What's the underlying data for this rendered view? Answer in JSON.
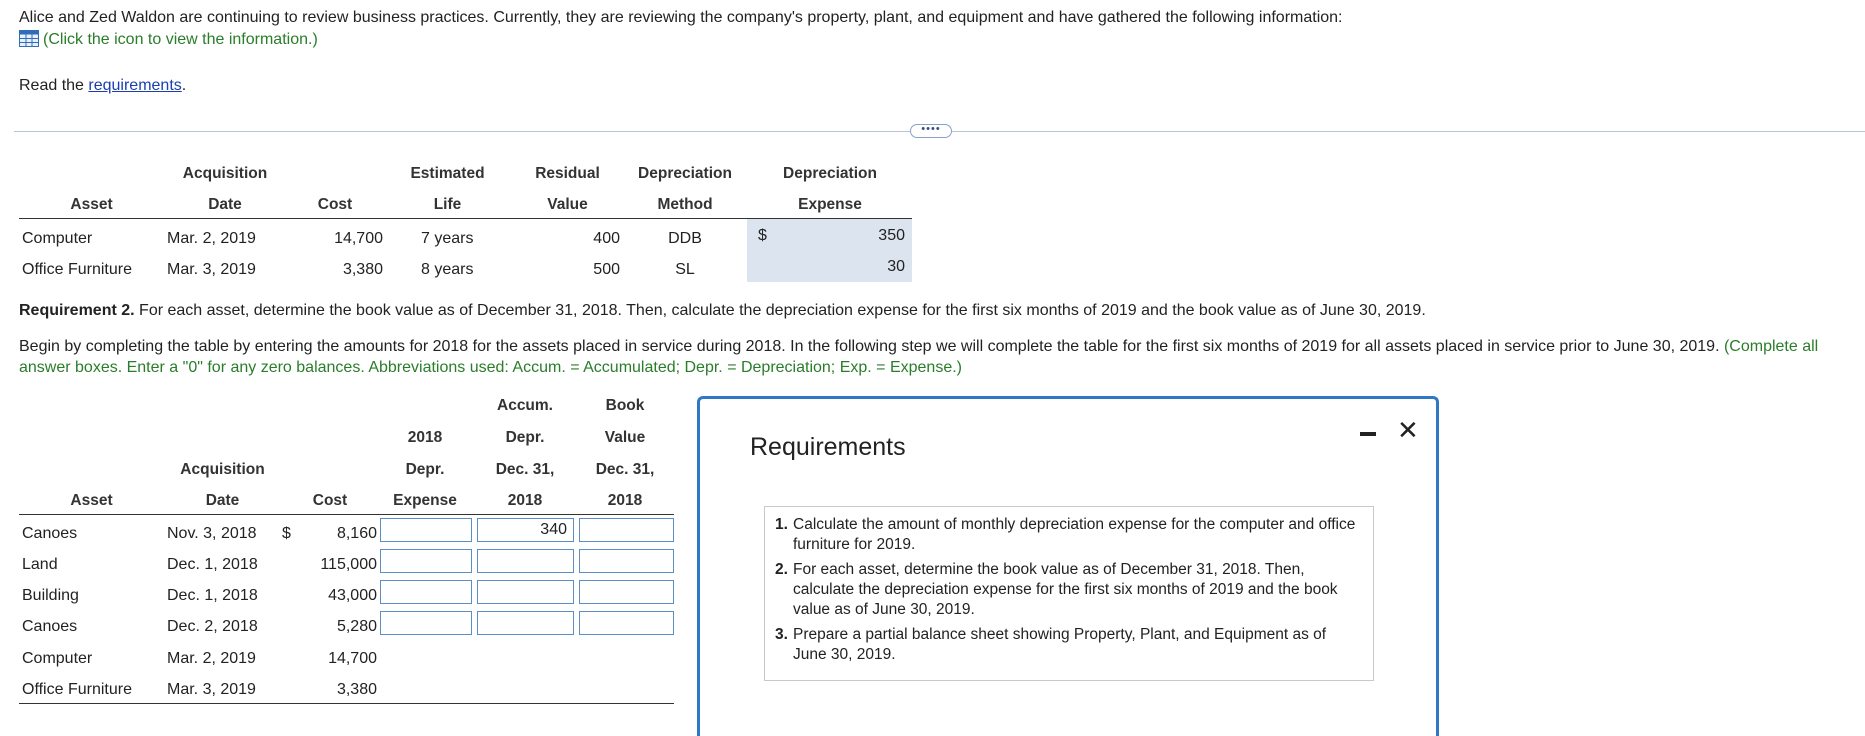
{
  "intro": {
    "line1": "Alice and Zed Waldon are continuing to review business practices. Currently, they are reviewing the company's property, plant, and equipment and have gathered the following information:",
    "click_text": "(Click the icon to view the information.)",
    "read_prefix": "Read the ",
    "requirements_link": "requirements",
    "read_suffix": "."
  },
  "more_button": "••••",
  "table1": {
    "headers": {
      "asset": "Asset",
      "acq_top": "Acquisition",
      "acq_bottom": "Date",
      "cost": "Cost",
      "life_top": "Estimated",
      "life_bottom": "Life",
      "resid_top": "Residual",
      "resid_bottom": "Value",
      "method_top": "Depreciation",
      "method_bottom": "Method",
      "exp_top": "Depreciation",
      "exp_bottom": "Expense"
    },
    "rows": [
      {
        "asset": "Computer",
        "date": "Mar. 2, 2019",
        "cost": "14,700",
        "life": "7 years",
        "residual": "400",
        "method": "DDB",
        "currency": "$",
        "expense": "350"
      },
      {
        "asset": "Office Furniture",
        "date": "Mar. 3, 2019",
        "cost": "3,380",
        "life": "8 years",
        "residual": "500",
        "method": "SL",
        "currency": "",
        "expense": "30"
      }
    ]
  },
  "requirement2": {
    "bold": "Requirement 2.",
    "text": " For each asset, determine the book value as of December 31, 2018. Then, calculate the depreciation expense for the first six months of 2019 and the book value as of June 30, 2019."
  },
  "instructions": {
    "black": "Begin by completing the table by entering the amounts for 2018 for the assets placed in service during 2018. In the following step we will complete the table for the first six months of 2019 for all assets placed in service prior to June 30, 2019. ",
    "green": "(Complete all answer boxes. Enter a \"0\" for any zero balances. Abbreviations used: Accum. = Accumulated; Depr. = Depreciation; Exp. = Expense.)"
  },
  "table2": {
    "headers": {
      "asset": "Asset",
      "acq_top": "Acquisition",
      "acq_bottom": "Date",
      "cost": "Cost",
      "depr_l1": "2018",
      "depr_l2": "Depr.",
      "depr_l3": "Expense",
      "accum_l1": "Accum.",
      "accum_l2": "Depr.",
      "accum_l3": "Dec. 31,",
      "accum_l4": "2018",
      "book_l1": "Book",
      "book_l2": "Value",
      "book_l3": "Dec. 31,",
      "book_l4": "2018"
    },
    "rows": [
      {
        "asset": "Canoes",
        "date": "Nov. 3, 2018",
        "currency": "$",
        "cost": "8,160",
        "depr": "",
        "accum": "340",
        "book": ""
      },
      {
        "asset": "Land",
        "date": "Dec. 1, 2018",
        "currency": "",
        "cost": "115,000",
        "depr": "",
        "accum": "",
        "book": ""
      },
      {
        "asset": "Building",
        "date": "Dec. 1, 2018",
        "currency": "",
        "cost": "43,000",
        "depr": "",
        "accum": "",
        "book": ""
      },
      {
        "asset": "Canoes",
        "date": "Dec. 2, 2018",
        "currency": "",
        "cost": "5,280",
        "depr": "",
        "accum": "",
        "book": ""
      },
      {
        "asset": "Computer",
        "date": "Mar. 2, 2019",
        "currency": "",
        "cost": "14,700"
      },
      {
        "asset": "Office Furniture",
        "date": "Mar. 3, 2019",
        "currency": "",
        "cost": "3,380"
      }
    ]
  },
  "modal": {
    "title": "Requirements",
    "minimize_glyph": "",
    "close_glyph": "✕",
    "items": [
      {
        "num": "1.",
        "text": "Calculate the amount of monthly depreciation expense for the computer and office furniture for 2019."
      },
      {
        "num": "2.",
        "text": "For each asset, determine the book value as of December 31, 2018. Then, calculate the depreciation expense for the first six months of 2019 and the book value as of June 30, 2019."
      },
      {
        "num": "3.",
        "text": "Prepare a partial balance sheet showing Property, Plant, and Equipment as of June 30, 2019."
      }
    ]
  },
  "colors": {
    "green_text": "#2a7d2a",
    "link_blue": "#1a3fb0",
    "input_border": "#5b8fc4",
    "shade": "#dce4ef",
    "modal_border": "#2f78c4"
  }
}
